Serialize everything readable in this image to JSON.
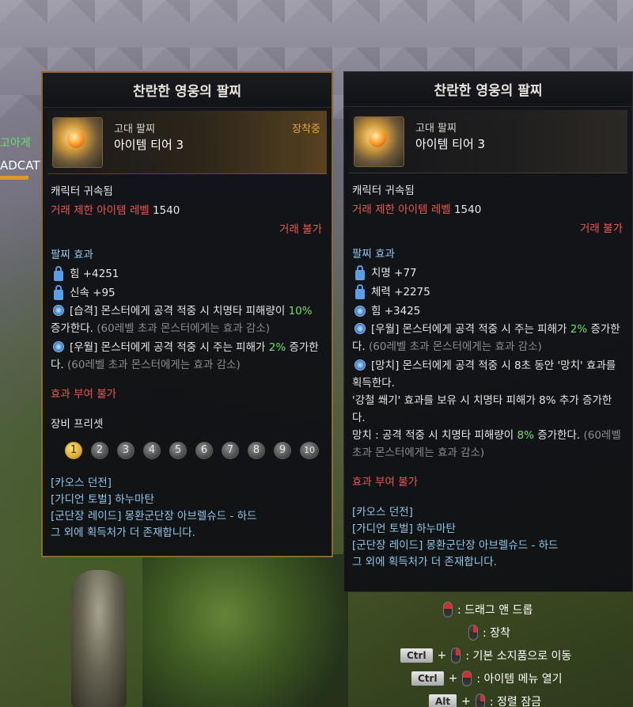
{
  "background": {
    "name_green": "고아게",
    "name_white": "ADCAT"
  },
  "tooltip_equipped": {
    "title": "찬란한 영웅의 팔찌",
    "grade": "고대 팔찌",
    "tier": "아이템 티어 3",
    "badge": "장착중",
    "bound": "캐릭터 귀속됨",
    "trade_limit_label": "거래 제한 아이템 레벨",
    "trade_limit_value": "1540",
    "trade_status": "거래 불가",
    "effect_title": "팔찌 효과",
    "stats": [
      {
        "label": "힘 +4251"
      },
      {
        "label": "신속 +95"
      }
    ],
    "effect1_tag": "[습격]",
    "effect1_pre": "몬스터에게 공격 적중 시 치명타 피해량이",
    "effect1_value": "10%",
    "effect1_post": "증가한다.",
    "effect1_note": "(60레벨 초과 몬스터에게는 효과 감소)",
    "effect2_tag": "[우월]",
    "effect2_pre": "몬스터에게 공격 적중 시 주는 피해가",
    "effect2_value": "2%",
    "effect2_post": "증가한다.",
    "effect2_note": "(60레벨 초과 몬스터에게는 효과 감소)",
    "no_enchant": "효과 부여 불가",
    "preset_label": "장비 프리셋",
    "presets": [
      "1",
      "2",
      "3",
      "4",
      "5",
      "6",
      "7",
      "8",
      "9",
      "10"
    ],
    "active_preset": "1",
    "sources": [
      "[카오스 던전]",
      "[가디언 토벌] 하누마탄",
      "[군단장 레이드] 몽환군단장 아브렐슈드 - 하드"
    ],
    "more_sources": "그 외에 획득처가 더 존재합니다."
  },
  "tooltip_compare": {
    "title": "찬란한 영웅의 팔찌",
    "grade": "고대 팔찌",
    "tier": "아이템 티어 3",
    "bound": "캐릭터 귀속됨",
    "trade_limit_label": "거래 제한 아이템 레벨",
    "trade_limit_value": "1540",
    "trade_status": "거래 불가",
    "effect_title": "팔찌 효과",
    "stats_locked": [
      {
        "label": "치명 +77"
      },
      {
        "label": "체력 +2275"
      }
    ],
    "stat_swirl": "힘 +3425",
    "effect1_tag": "[우월]",
    "effect1_pre": "몬스터에게 공격 적중 시 주는 피해가",
    "effect1_value": "2%",
    "effect1_post": "증가한다.",
    "effect1_note": "(60레벨 초과 몬스터에게는 효과 감소)",
    "effect2_tag": "[망치]",
    "effect2_line1": "몬스터에게 공격 적중 시 8초 동안 '망치' 효과를 획득한다.",
    "effect2_line2": "'강철 쐐기' 효과를 보유 시 치명타 피해가 8% 추가 증가한다.",
    "effect2_line3_pre": "망치 : 공격 적중 시 치명타 피해량이",
    "effect2_line3_value": "8%",
    "effect2_line3_post": "증가한다.",
    "effect2_note": "(60레벨 초과 몬스터에게는 효과 감소)",
    "no_enchant": "효과 부여 불가",
    "sources": [
      "[카오스 던전]",
      "[가디언 토벌] 하누마탄",
      "[군단장 레이드] 몽환군단장 아브렐슈드 - 하드"
    ],
    "more_sources": "그 외에 획득처가 더 존재합니다."
  },
  "controls": [
    {
      "keys": [],
      "mouse": "left",
      "text": ": 드래그 앤 드롭"
    },
    {
      "keys": [],
      "mouse": "right",
      "text": ": 장착"
    },
    {
      "keys": [
        "Ctrl"
      ],
      "mouse": "right",
      "text": ": 기본 소지품으로 이동"
    },
    {
      "keys": [
        "Ctrl"
      ],
      "mouse": "left",
      "text": ": 아이템 메뉴 열기"
    },
    {
      "keys": [
        "Alt"
      ],
      "mouse": "right",
      "text": ": 정렬 잠금"
    }
  ],
  "colors": {
    "accent_gold": "#8c6a2e",
    "equipped_badge": "#e4a447",
    "red_text": "#e85a4f",
    "green_value": "#6ee06e",
    "blue_text": "#8ec8ec"
  }
}
